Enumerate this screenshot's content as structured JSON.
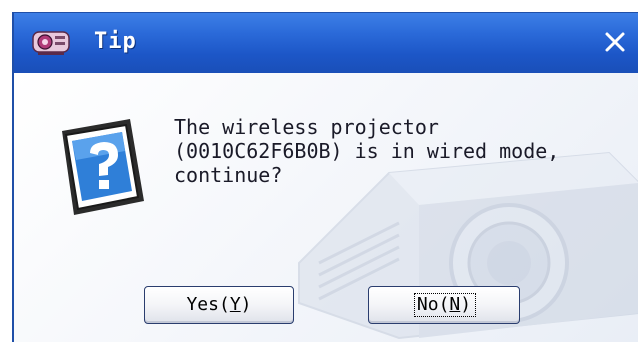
{
  "window": {
    "title": "Tip",
    "close_glyph": "✕",
    "title_icon": "projector-app-icon",
    "accent_color": "#1f4fa8"
  },
  "dialog": {
    "icon": "help-question-icon",
    "message_lines": [
      "The wireless projector",
      "(0010C62F6B0B) is in wired mode,",
      "continue?"
    ]
  },
  "buttons": {
    "yes": {
      "label": "Yes",
      "mnemonic": "Y"
    },
    "no": {
      "label": "No",
      "mnemonic": "N"
    }
  }
}
